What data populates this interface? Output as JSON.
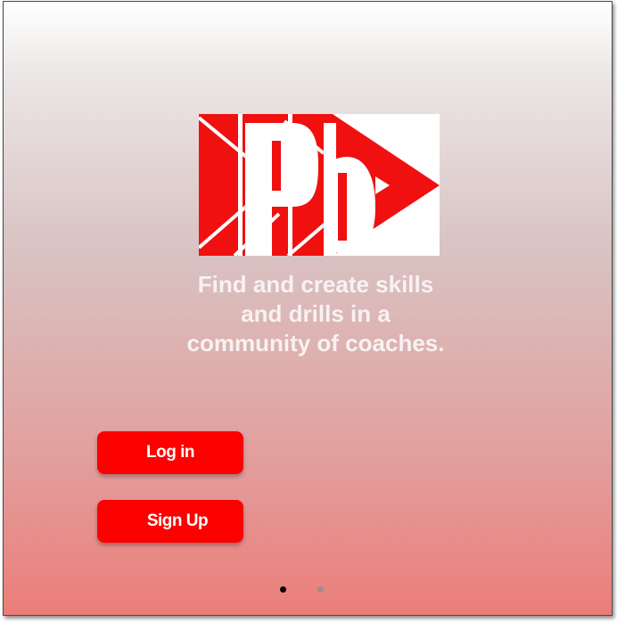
{
  "logo": {
    "text": "Pb",
    "colors": {
      "red": "#f01010",
      "white": "#ffffff"
    }
  },
  "tagline": "Find and create skills\nand drills in a\ncommunity of coaches.",
  "buttons": {
    "login_label": "Log in",
    "signup_label": "Sign Up"
  },
  "pager": {
    "total_pages": 2,
    "current_page": 1
  },
  "colors": {
    "button_bg": "#fd0000",
    "button_text": "#ffffff",
    "tagline_text": "#f7f2f2",
    "gradient_top": "#ffffff",
    "gradient_bottom": "#ec7d79"
  }
}
